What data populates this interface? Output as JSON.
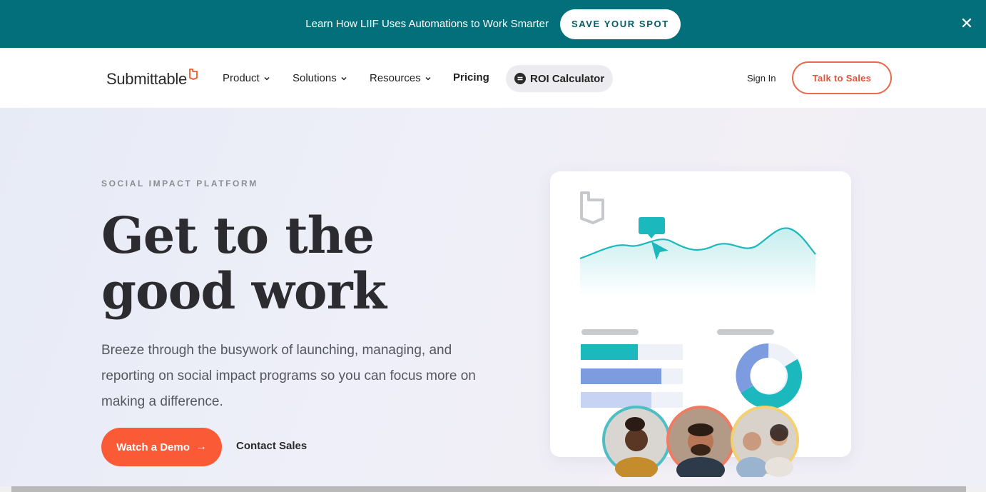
{
  "announcement": {
    "text": "Learn How LIIF Uses Automations to Work Smarter",
    "cta_label": "SAVE YOUR SPOT",
    "close_icon": "close-icon",
    "bg_color": "#036f7a"
  },
  "nav": {
    "logo_text": "Submittable",
    "items": [
      {
        "label": "Product",
        "has_dropdown": true
      },
      {
        "label": "Solutions",
        "has_dropdown": true
      },
      {
        "label": "Resources",
        "has_dropdown": true
      },
      {
        "label": "Pricing",
        "has_dropdown": false
      }
    ],
    "roi_label": "ROI Calculator",
    "sign_in": "Sign In",
    "talk_to_sales": "Talk to Sales",
    "accent_color": "#e96a4c"
  },
  "hero": {
    "eyebrow": "SOCIAL IMPACT PLATFORM",
    "headline_line1": "Get to the",
    "headline_line2": "good work",
    "subtext": "Breeze through the busywork of launching, managing, and reporting on social impact programs so you can focus more on making a difference.",
    "primary_cta": "Watch a Demo",
    "secondary_cta": "Contact Sales",
    "primary_color": "#fb5a36"
  },
  "illustration": {
    "icons": [
      "logo-mark-icon",
      "chat-bubble-icon",
      "cursor-icon",
      "donut-chart-icon"
    ],
    "avatars": [
      "avatar-woman",
      "avatar-man",
      "avatar-couple"
    ],
    "bar_fills": [
      0.56,
      0.79,
      0.69
    ],
    "teal": "#1bb8bd",
    "blue": "#7d9ce0"
  }
}
